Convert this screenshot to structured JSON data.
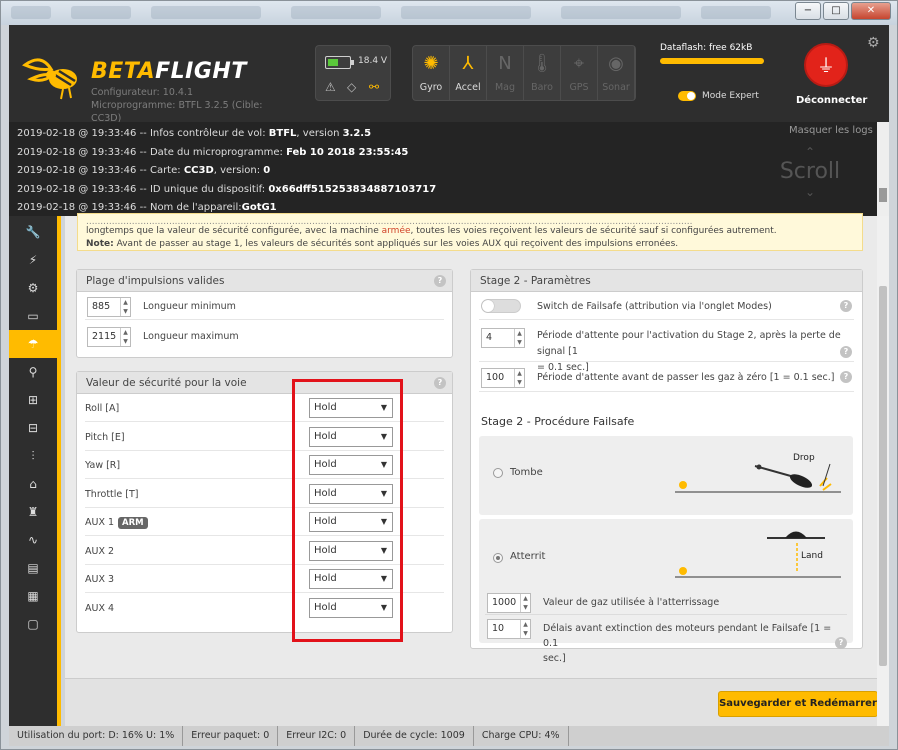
{
  "window": {
    "controls": {
      "minimize": "−",
      "maximize": "□",
      "close": "✕"
    }
  },
  "header": {
    "brand_left": "BETA",
    "brand_right": "FLIGHT",
    "configurator": "Configurateur: 10.4.1",
    "firmware": "Microprogramme: BTFL 3.2.5 (Cible:",
    "firmware2": "CC3D)",
    "battery_voltage": "18.4 V",
    "sensors": [
      {
        "label": "Gyro",
        "glyph": "✺",
        "icon": "gyro-icon",
        "active": true
      },
      {
        "label": "Accel",
        "glyph": "⅄",
        "icon": "accel-icon",
        "active": true
      },
      {
        "label": "Mag",
        "glyph": "N",
        "icon": "mag-icon",
        "active": false
      },
      {
        "label": "Baro",
        "glyph": "🌡",
        "icon": "baro-icon",
        "active": false
      },
      {
        "label": "GPS",
        "glyph": "⌖",
        "icon": "gps-icon",
        "active": false
      },
      {
        "label": "Sonar",
        "glyph": "◉",
        "icon": "sonar-icon",
        "active": false
      }
    ],
    "dataflash": "Dataflash: free 62kB",
    "expert_mode": "Mode Expert",
    "disconnect": "Déconnecter"
  },
  "log": {
    "hide": "Masquer les logs",
    "scroll": "Scroll",
    "lines": [
      {
        "prefix": "2019-02-18 @ 19:33:46 -- Infos contrôleur de vol: ",
        "bold": "BTFL",
        "mid": ", version ",
        "bold2": "3.2.5"
      },
      {
        "prefix": "2019-02-18 @ 19:33:46 -- Date du microprogramme: ",
        "bold": "Feb 10 2018 23:55:45",
        "mid": "",
        "bold2": ""
      },
      {
        "prefix": "2019-02-18 @ 19:33:46 -- Carte: ",
        "bold": "CC3D",
        "mid": ", version: ",
        "bold2": "0"
      },
      {
        "prefix": "2019-02-18 @ 19:33:46 -- ID unique du dispositif: ",
        "bold": "0x66dff515253834887103717",
        "mid": "",
        "bold2": ""
      },
      {
        "prefix": "2019-02-18 @ 19:33:46 -- Nom de l'appareil:",
        "bold": "GotG1",
        "mid": "",
        "bold2": ""
      }
    ]
  },
  "note": {
    "line1a": "longtemps que la valeur de sécurité configurée, avec la machine ",
    "line1b": "armée",
    "line1c": ", toutes les voies reçoivent les valeurs de sécurité sauf si configurées autrement.",
    "line2a": "Note:",
    "line2b": " Avant de passer au stage 1, les valeurs de sécurités sont appliqués sur les voies AUX qui reçoivent des impulsions erronées."
  },
  "pulse_panel": {
    "title": "Plage d'impulsions valides",
    "min_value": "885",
    "min_label": "Longueur minimum",
    "max_value": "2115",
    "max_label": "Longueur maximum"
  },
  "channel_panel": {
    "title": "Valeur de sécurité pour la voie",
    "arm_badge": "ARM",
    "channels": [
      {
        "label": "Roll [A]",
        "value": "Hold"
      },
      {
        "label": "Pitch [E]",
        "value": "Hold"
      },
      {
        "label": "Yaw [R]",
        "value": "Hold"
      },
      {
        "label": "Throttle [T]",
        "value": "Hold"
      },
      {
        "label": "AUX 1",
        "value": "Hold"
      },
      {
        "label": "AUX 2",
        "value": "Hold"
      },
      {
        "label": "AUX 3",
        "value": "Hold"
      },
      {
        "label": "AUX 4",
        "value": "Hold"
      }
    ]
  },
  "stage2_panel": {
    "title": "Stage 2 - Paramètres",
    "switch_label": "Switch de Failsafe (attribution via l'onglet Modes)",
    "delay_value": "4",
    "delay_label1": "Période d'attente pour l'activation du Stage 2, après la perte de signal [1",
    "delay_label2": "= 0.1 sec.]",
    "throttle_value": "100",
    "throttle_label": "Période d'attente avant de passer les gaz à zéro [1 = 0.1 sec.]",
    "procedure_title": "Stage 2 - Procédure Failsafe",
    "drop_label": "Tombe",
    "drop_caption": "Drop",
    "land_label": "Atterrit",
    "land_caption": "Land",
    "land_throttle_value": "1000",
    "land_throttle_label": "Valeur de gaz utilisée à l'atterrissage",
    "motor_delay_value": "10",
    "motor_delay_label1": "Délais avant extinction des moteurs pendant le Failsafe [1 = 0.1",
    "motor_delay_label2": "sec.]"
  },
  "save_button": "Sauvegarder et Redémarrer",
  "status_bar": [
    "Utilisation du port: D: 16% U: 1%",
    "Erreur paquet: 0",
    "Erreur I2C: 0",
    "Durée de cycle: 1009",
    "Charge CPU: 4%"
  ],
  "colors": {
    "accent": "#ffbb00",
    "highlight": "#e2121a",
    "disconnect": "#e2231a"
  }
}
